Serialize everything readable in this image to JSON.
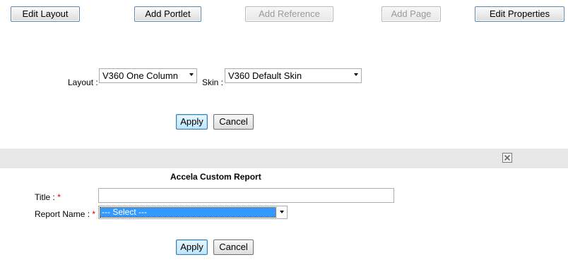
{
  "toolbar": {
    "edit_layout": "Edit Layout",
    "add_portlet": "Add Portlet",
    "add_reference": "Add Reference",
    "add_page": "Add Page",
    "edit_properties": "Edit Properties"
  },
  "layout_form": {
    "layout_label": "Layout :",
    "layout_value": "V360 One Column",
    "skin_label": "Skin :",
    "skin_value": "V360 Default Skin",
    "apply_label": "Apply",
    "cancel_label": "Cancel"
  },
  "portlet": {
    "close_icon": "close-icon",
    "title": "Accela Custom Report",
    "title_field_label": "Title :",
    "title_value": "",
    "required_mark": "*",
    "report_name_label": "Report Name :",
    "report_name_value": "--- Select ---",
    "apply_label": "Apply",
    "cancel_label": "Cancel"
  },
  "colors": {
    "toolbar_border": "#5b87b2",
    "bar_background": "#e7e7e7",
    "selection_highlight": "#3399ff",
    "required": "#cc0000"
  }
}
